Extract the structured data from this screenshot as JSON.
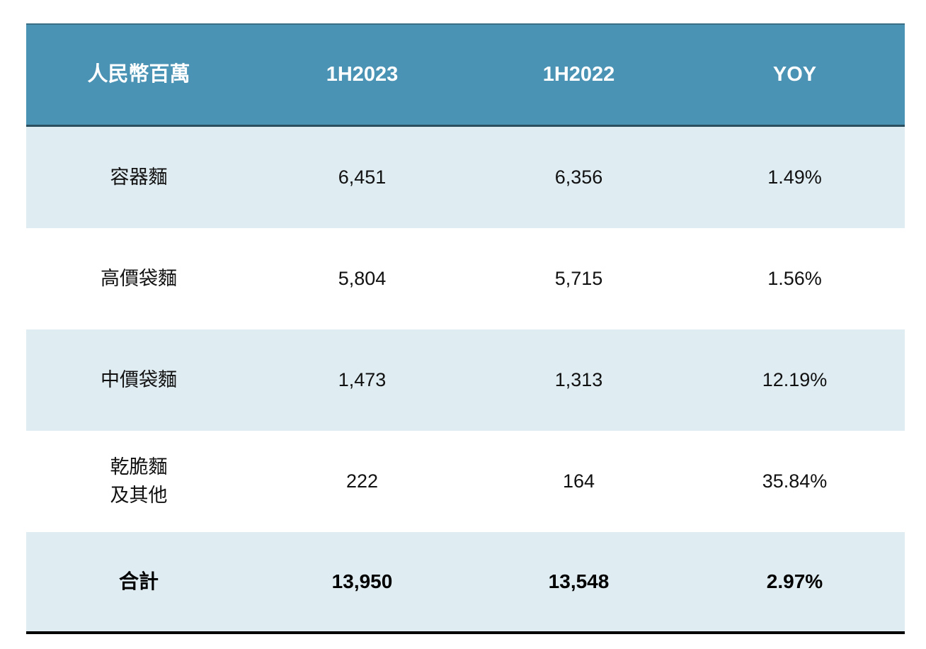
{
  "table": {
    "headers": [
      "人民幣百萬",
      "1H2023",
      "1H2022",
      "YOY"
    ],
    "rows": [
      [
        "容器麵",
        "6,451",
        "6,356",
        "1.49%"
      ],
      [
        "高價袋麵",
        "5,804",
        "5,715",
        "1.56%"
      ],
      [
        "中價袋麵",
        "1,473",
        "1,313",
        "12.19%"
      ],
      [
        "乾脆麵\n及其他",
        "222",
        "164",
        "35.84%"
      ]
    ],
    "total": [
      "合計",
      "13,950",
      "13,548",
      "2.97%"
    ]
  },
  "colors": {
    "header_bg": "#4a93b4",
    "header_text": "#ffffff",
    "row_shade": "#dfecf2",
    "row_plain": "#ffffff"
  }
}
